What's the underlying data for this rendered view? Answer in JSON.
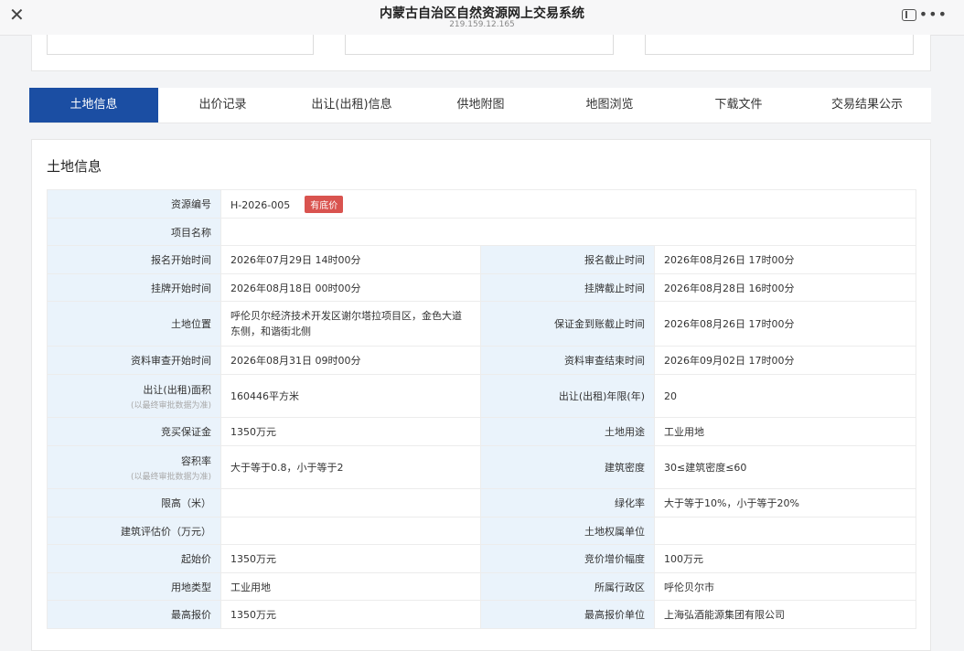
{
  "window": {
    "title": "内蒙古自治区自然资源网上交易系统",
    "url": "219.159.12.165",
    "close_glyph": "✕",
    "more_glyph": "•••"
  },
  "tabs": [
    {
      "label": "土地信息",
      "active": true
    },
    {
      "label": "出价记录",
      "active": false
    },
    {
      "label": "出让(出租)信息",
      "active": false
    },
    {
      "label": "供地附图",
      "active": false
    },
    {
      "label": "地图浏览",
      "active": false
    },
    {
      "label": "下载文件",
      "active": false
    },
    {
      "label": "交易结果公示",
      "active": false
    }
  ],
  "section": {
    "title": "土地信息"
  },
  "info": {
    "resource_no": {
      "label": "资源编号",
      "value": "H-2026-005",
      "badge": "有底价"
    },
    "project_name": {
      "label": "项目名称",
      "value": ""
    },
    "signup_start": {
      "label": "报名开始时间",
      "value": "2026年07月29日 14时00分"
    },
    "signup_end": {
      "label": "报名截止时间",
      "value": "2026年08月26日 17时00分"
    },
    "listing_start": {
      "label": "挂牌开始时间",
      "value": "2026年08月18日 00时00分"
    },
    "listing_end": {
      "label": "挂牌截止时间",
      "value": "2026年08月28日 16时00分"
    },
    "location": {
      "label": "土地位置",
      "value": "呼伦贝尔经济技术开发区谢尔塔拉项目区，金色大道东侧，和谐街北侧"
    },
    "deposit_deadline": {
      "label": "保证金到账截止时间",
      "value": "2026年08月26日 17时00分"
    },
    "review_start": {
      "label": "资料审查开始时间",
      "value": "2026年08月31日 09时00分"
    },
    "review_end": {
      "label": "资料审查结束时间",
      "value": "2026年09月02日 17时00分"
    },
    "area": {
      "label": "出让(出租)面积",
      "sublabel": "(以最终审批数据为准)",
      "value": "160446平方米"
    },
    "term": {
      "label": "出让(出租)年限(年)",
      "value": "20"
    },
    "bid_deposit": {
      "label": "竞买保证金",
      "value": "1350万元"
    },
    "land_use": {
      "label": "土地用途",
      "value": "工业用地"
    },
    "plot_ratio": {
      "label": "容积率",
      "sublabel": "(以最终审批数据为准)",
      "value": "大于等于0.8，小于等于2"
    },
    "building_density": {
      "label": "建筑密度",
      "value": "30≤建筑密度≤60"
    },
    "height_limit": {
      "label": "限高（米）",
      "value": ""
    },
    "green_ratio": {
      "label": "绿化率",
      "value": "大于等于10%，小于等于20%"
    },
    "building_valuation": {
      "label": "建筑评估价（万元）",
      "value": ""
    },
    "ownership_unit": {
      "label": "土地权属单位",
      "value": ""
    },
    "start_price": {
      "label": "起始价",
      "value": "1350万元"
    },
    "bid_increment": {
      "label": "竞价增价幅度",
      "value": "100万元"
    },
    "land_type": {
      "label": "用地类型",
      "value": "工业用地"
    },
    "district": {
      "label": "所属行政区",
      "value": "呼伦贝尔市"
    },
    "highest_bid": {
      "label": "最高报价",
      "value": "1350万元"
    },
    "highest_bidder": {
      "label": "最高报价单位",
      "value": "上海弘酒能源集团有限公司"
    }
  }
}
